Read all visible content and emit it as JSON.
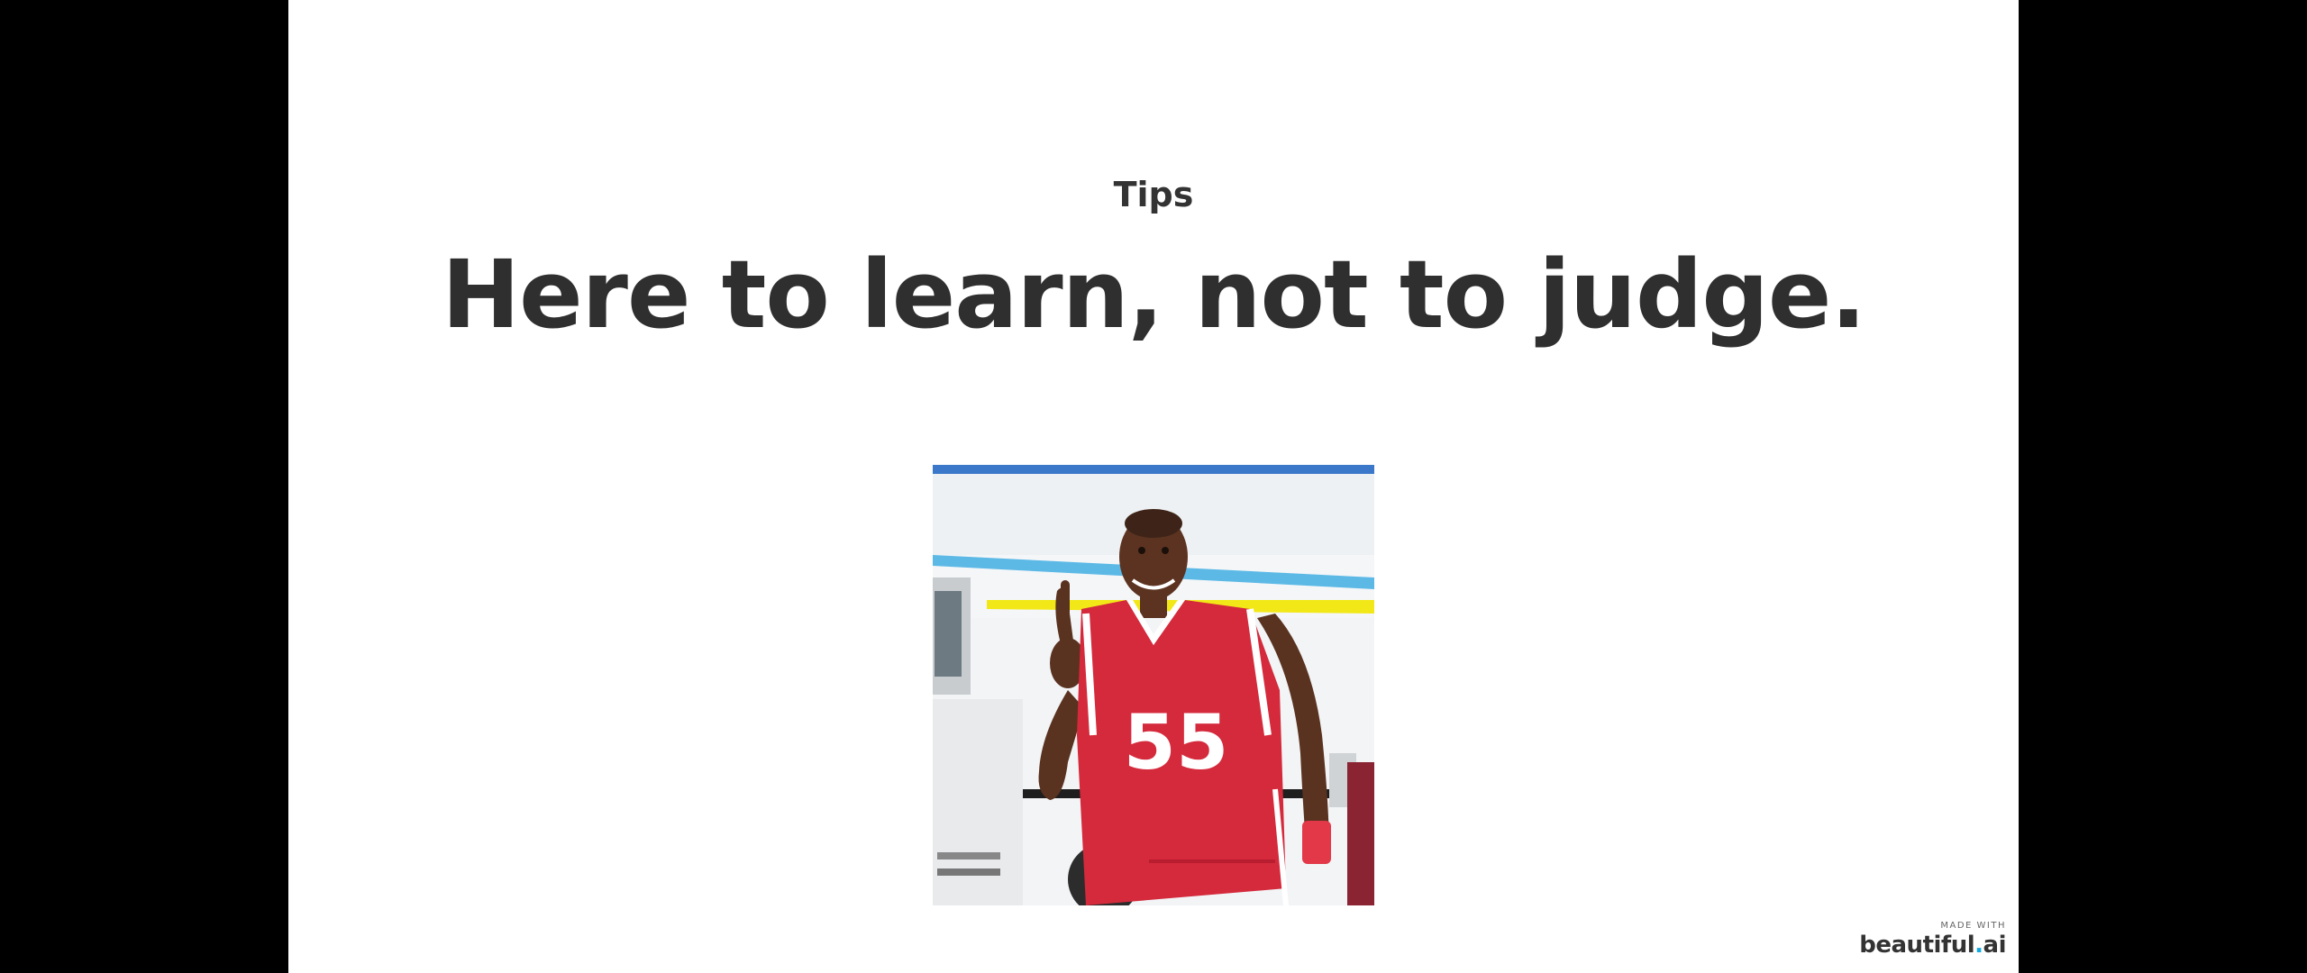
{
  "slide": {
    "eyebrow": "Tips",
    "headline": "Here to learn, not to judge.",
    "image": {
      "description_icon": "basketball-player-finger-wag-photo",
      "jersey_number": "55"
    }
  },
  "footer": {
    "made_with": "MADE WITH",
    "brand_name": "beautiful",
    "brand_dot": ".",
    "brand_suffix": "ai"
  },
  "colors": {
    "background": "#ffffff",
    "text": "#333333",
    "letterbox": "#000000",
    "jersey_red": "#d42a3c",
    "brand_accent": "#11a9e2"
  }
}
